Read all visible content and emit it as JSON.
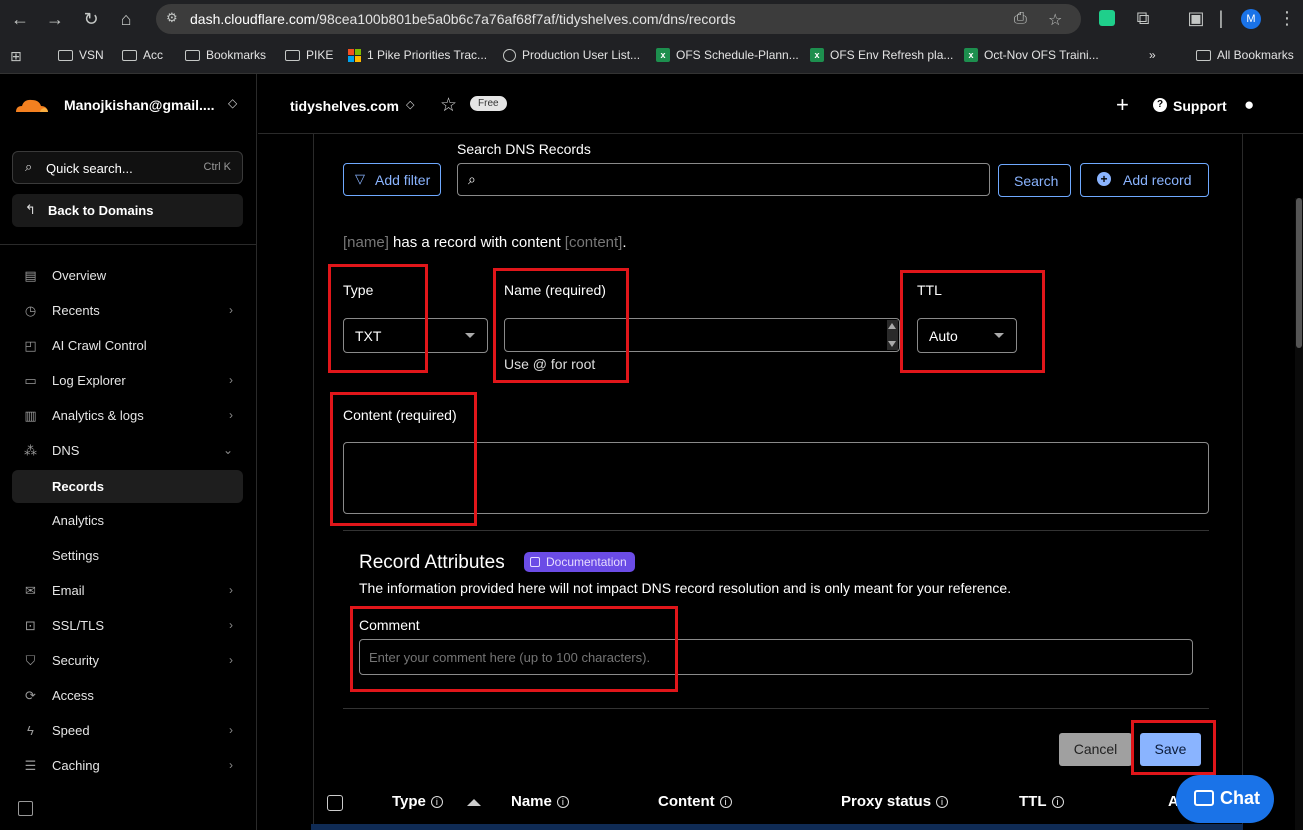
{
  "browser": {
    "url_host": "dash.cloudflare.com",
    "url_path": "/98cea100b801be5a0b6c7a76af68f7af/tidyshelves.com/dns/records",
    "profile_initial": "M",
    "bookmarks": [
      "VSN",
      "Acc",
      "Bookmarks",
      "PIKE",
      "1 Pike Priorities Trac...",
      "Production User List...",
      "OFS Schedule-Plann...",
      "OFS Env Refresh pla...",
      "Oct-Nov OFS Traini...",
      "»",
      "All Bookmarks"
    ]
  },
  "sidebar": {
    "account": "Manojkishan@gmail....",
    "quick_search": "Quick search...",
    "quick_search_kbd": "Ctrl K",
    "back": "Back to Domains",
    "items": [
      {
        "label": "Overview"
      },
      {
        "label": "Recents"
      },
      {
        "label": "AI Crawl Control"
      },
      {
        "label": "Log Explorer"
      },
      {
        "label": "Analytics & logs"
      },
      {
        "label": "DNS"
      },
      {
        "label": "Records"
      },
      {
        "label": "Analytics"
      },
      {
        "label": "Settings"
      },
      {
        "label": "Email"
      },
      {
        "label": "SSL/TLS"
      },
      {
        "label": "Security"
      },
      {
        "label": "Access"
      },
      {
        "label": "Speed"
      },
      {
        "label": "Caching"
      }
    ]
  },
  "topbar": {
    "zone": "tidyshelves.com",
    "plan": "Free",
    "support": "Support"
  },
  "search": {
    "label": "Search DNS Records",
    "add_filter": "Add filter",
    "search_button": "Search",
    "add_record": "Add record"
  },
  "form": {
    "preview_name": "[name]",
    "preview_mid": "has a record with content",
    "preview_content": "[content]",
    "preview_end": ".",
    "type_label": "Type",
    "type_value": "TXT",
    "name_label": "Name (required)",
    "name_hint": "Use @ for root",
    "ttl_label": "TTL",
    "ttl_value": "Auto",
    "content_label": "Content (required)",
    "attributes_title": "Record Attributes",
    "documentation": "Documentation",
    "attributes_note": "The information provided here will not impact DNS record resolution and is only meant for your reference.",
    "comment_label": "Comment",
    "comment_placeholder": "Enter your comment here (up to 100 characters).",
    "cancel": "Cancel",
    "save": "Save"
  },
  "table": {
    "headers": [
      "Type",
      "Name",
      "Content",
      "Proxy status",
      "TTL",
      "A"
    ]
  },
  "chat": "Chat",
  "colors": {
    "accent": "#8ab4ff",
    "highlight_red": "#e0161a",
    "doc_badge": "#6b4ce6",
    "chat": "#1a73e8"
  }
}
